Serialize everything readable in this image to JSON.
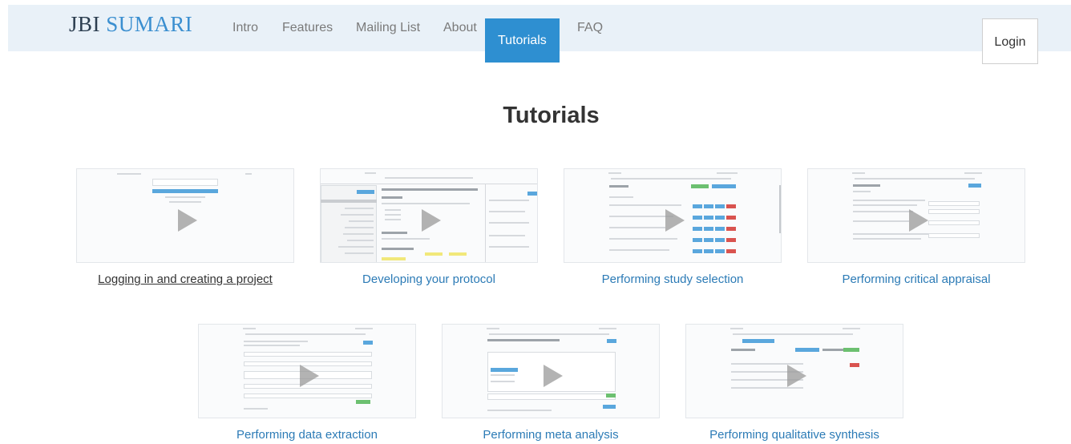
{
  "brand": {
    "part1": "JBI ",
    "part2": "SUMARI"
  },
  "nav": {
    "items": [
      {
        "label": "Intro"
      },
      {
        "label": "Features"
      },
      {
        "label": "Mailing List"
      },
      {
        "label": "About"
      },
      {
        "label": "Tutorials",
        "active": true
      },
      {
        "label": "FAQ"
      }
    ],
    "login_label": "Login"
  },
  "page": {
    "title": "Tutorials"
  },
  "tutorials": [
    {
      "caption": "Logging in and creating a project",
      "icon": "play-icon"
    },
    {
      "caption": "Developing your protocol",
      "icon": "play-icon"
    },
    {
      "caption": "Performing study selection",
      "icon": "play-icon"
    },
    {
      "caption": "Performing critical appraisal",
      "icon": "play-icon"
    },
    {
      "caption": "Performing data extraction",
      "icon": "play-icon"
    },
    {
      "caption": "Performing meta analysis",
      "icon": "play-icon"
    },
    {
      "caption": "Performing qualitative synthesis",
      "icon": "play-icon"
    }
  ],
  "colors": {
    "accent": "#2e8fd1",
    "link": "#2c7bb6",
    "navbar_bg": "#e9f1f8"
  }
}
